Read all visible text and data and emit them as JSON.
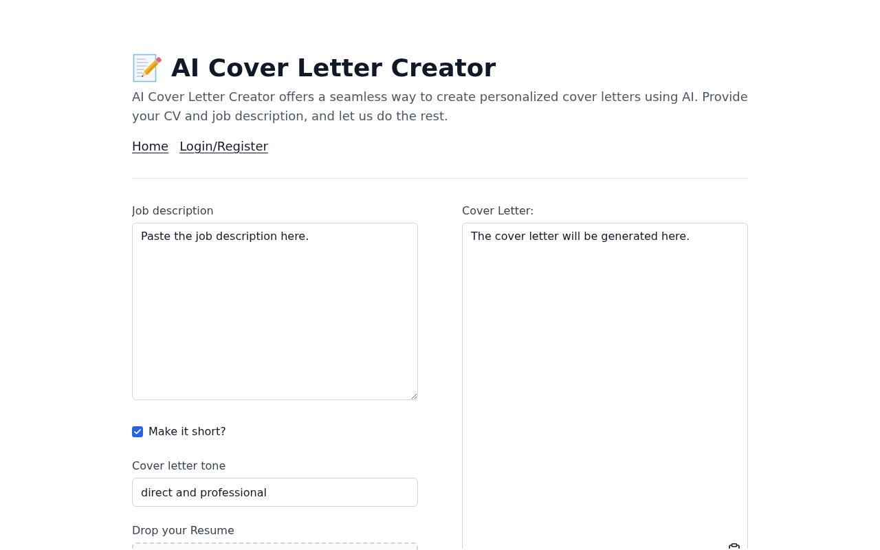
{
  "header": {
    "title": "AI Cover Letter Creator",
    "description": "AI Cover Letter Creator offers a seamless way to create personalized cover letters using AI. Provide your CV and job description, and let us do the rest.",
    "nav_links": [
      {
        "label": "Home"
      },
      {
        "label": "Login/Register"
      }
    ]
  },
  "form": {
    "job_description": {
      "label": "Job description",
      "value": "Paste the job description here."
    },
    "short_option": {
      "label": "Make it short?",
      "checked": true
    },
    "tone": {
      "label": "Cover letter tone",
      "value": "direct and professional"
    },
    "resume_upload": {
      "label": "Drop your Resume"
    }
  },
  "output": {
    "label": "Cover Letter:",
    "value": "The cover letter will be generated here."
  }
}
